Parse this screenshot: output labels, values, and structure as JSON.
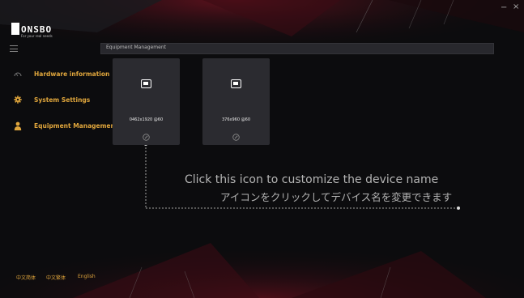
{
  "window": {
    "minimize_label": "−",
    "close_label": "×"
  },
  "brand": {
    "name": "ONSBO",
    "tagline": "For your real needs"
  },
  "sidebar": {
    "items": [
      {
        "label": "Hardware information",
        "icon": "gauge-icon"
      },
      {
        "label": "System Settings",
        "icon": "gear-icon"
      },
      {
        "label": "Equipment Management",
        "icon": "user-icon"
      }
    ]
  },
  "header": {
    "title": "Equipment Management"
  },
  "devices": [
    {
      "resolution": "0462x1920 @60"
    },
    {
      "resolution": "376x960 @60"
    }
  ],
  "annotation": {
    "english": "Click this icon to customize the device name",
    "japanese": "アイコンをクリックしてデバイス名を変更できます"
  },
  "languages": [
    "中文简体",
    "中文繁体",
    "English"
  ],
  "colors": {
    "accent": "#e0a63c",
    "background": "#0b0b0d",
    "card": "#2b2b30",
    "red_glow": "#7a1420"
  }
}
